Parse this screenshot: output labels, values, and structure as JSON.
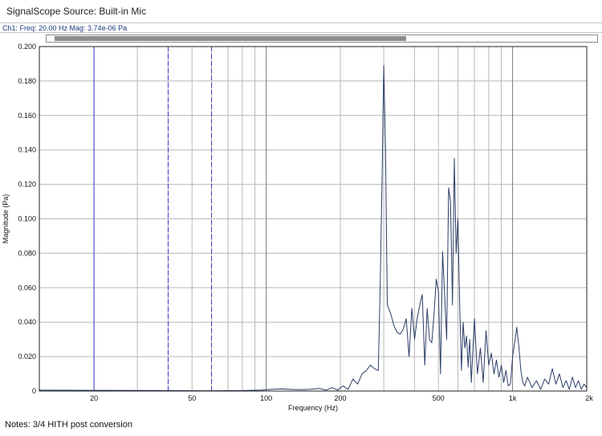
{
  "title_bar": {
    "text": "SignalScope Source:  Built-in Mic"
  },
  "readout": {
    "text": "Ch1:  Freq: 20.00 Hz   Mag: 3.74e-06 Pa"
  },
  "notes": {
    "text": "Notes: 3/4 HITH post conversion"
  },
  "colors": {
    "trace": "#2b3d66",
    "cursor": "#3a3ad0",
    "grid": "#b8b8b8",
    "decade_grid": "#7a7a7a",
    "axis": "#222222"
  },
  "scrollbar": {
    "thumb_fraction": 0.65
  },
  "chart_data": {
    "type": "line",
    "xlabel": "Frequency (Hz)",
    "ylabel": "Magnitude (Pa)",
    "x_scale": "log",
    "xlim": [
      12,
      2000
    ],
    "ylim": [
      0,
      0.2
    ],
    "grid": true,
    "x_tick_labels": [
      "20",
      "50",
      "100",
      "200",
      "500",
      "1k",
      "2k"
    ],
    "x_tick_values": [
      20,
      50,
      100,
      200,
      500,
      1000,
      2000
    ],
    "y_tick_labels": [
      "0",
      "0.020",
      "0.040",
      "0.060",
      "0.080",
      "0.100",
      "0.120",
      "0.140",
      "0.160",
      "0.180",
      "0.200"
    ],
    "y_tick_values": [
      0,
      0.02,
      0.04,
      0.06,
      0.08,
      0.1,
      0.12,
      0.14,
      0.16,
      0.18,
      0.2
    ],
    "cursors": [
      20,
      40,
      60
    ],
    "series": [
      {
        "x": [
          12,
          20,
          40,
          60,
          80,
          95,
          105,
          115,
          125,
          135,
          150,
          165,
          175,
          185,
          195,
          205,
          215,
          225,
          235,
          245,
          255,
          265,
          275,
          285,
          290,
          295,
          300,
          305,
          310,
          320,
          330,
          340,
          350,
          360,
          370,
          380,
          390,
          400,
          410,
          420,
          430,
          440,
          450,
          460,
          470,
          480,
          490,
          500,
          510,
          520,
          530,
          540,
          550,
          560,
          570,
          580,
          590,
          600,
          610,
          620,
          630,
          640,
          650,
          660,
          670,
          680,
          700,
          720,
          740,
          760,
          780,
          800,
          820,
          840,
          860,
          880,
          900,
          920,
          940,
          960,
          980,
          1000,
          1020,
          1040,
          1060,
          1080,
          1100,
          1120,
          1150,
          1200,
          1250,
          1300,
          1350,
          1400,
          1450,
          1500,
          1550,
          1600,
          1650,
          1700,
          1750,
          1800,
          1850,
          1900,
          1950,
          2000
        ],
        "y": [
          0.0005,
          0.0004,
          0.0003,
          0.0002,
          0.0003,
          0.0005,
          0.001,
          0.0012,
          0.001,
          0.0008,
          0.001,
          0.0015,
          0.0005,
          0.002,
          0.0005,
          0.003,
          0.001,
          0.007,
          0.004,
          0.01,
          0.012,
          0.015,
          0.013,
          0.012,
          0.06,
          0.12,
          0.189,
          0.14,
          0.05,
          0.045,
          0.038,
          0.034,
          0.033,
          0.036,
          0.042,
          0.02,
          0.048,
          0.03,
          0.042,
          0.05,
          0.056,
          0.015,
          0.048,
          0.03,
          0.028,
          0.045,
          0.065,
          0.058,
          0.01,
          0.081,
          0.055,
          0.03,
          0.118,
          0.11,
          0.05,
          0.135,
          0.08,
          0.1,
          0.05,
          0.012,
          0.04,
          0.025,
          0.032,
          0.014,
          0.03,
          0.005,
          0.042,
          0.01,
          0.025,
          0.005,
          0.035,
          0.015,
          0.022,
          0.01,
          0.018,
          0.008,
          0.015,
          0.005,
          0.012,
          0.003,
          0.004,
          0.02,
          0.028,
          0.037,
          0.026,
          0.012,
          0.005,
          0.003,
          0.008,
          0.002,
          0.006,
          0.001,
          0.007,
          0.004,
          0.013,
          0.004,
          0.01,
          0.002,
          0.006,
          0.001,
          0.008,
          0.002,
          0.006,
          0.001,
          0.004,
          0.002
        ]
      }
    ]
  }
}
